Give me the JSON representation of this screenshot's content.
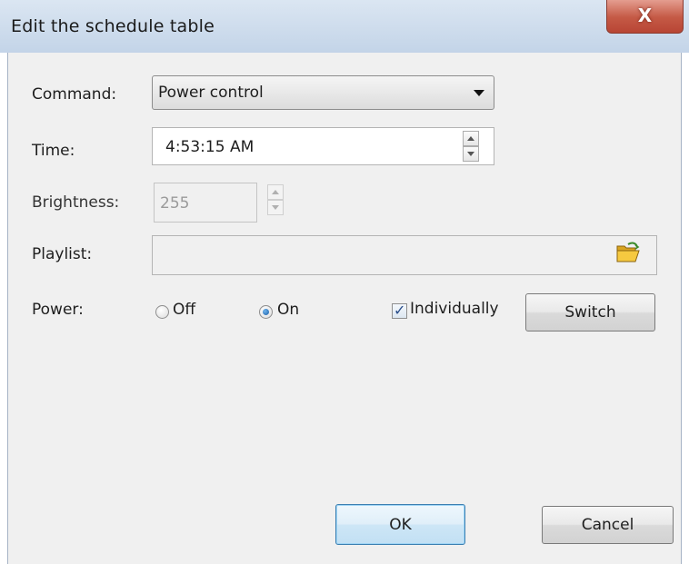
{
  "window": {
    "title": "Edit the schedule table",
    "close_glyph": "X"
  },
  "form": {
    "command_label": "Command:",
    "command_value": "Power control",
    "time_label": "Time:",
    "time_value": "4:53:15 AM",
    "brightness_label": "Brightness:",
    "brightness_value": "255",
    "playlist_label": "Playlist:",
    "playlist_value": "",
    "power_label": "Power:",
    "power_off_label": "Off",
    "power_on_label": "On",
    "power_selected": "On",
    "individually_label": "Individually",
    "individually_checked": true,
    "switch_label": "Switch"
  },
  "footer": {
    "ok_label": "OK",
    "cancel_label": "Cancel"
  },
  "icons": {
    "close": "close-icon",
    "dropdown": "chevron-down-icon",
    "spin_up": "spin-up-icon",
    "spin_down": "spin-down-icon",
    "browse": "folder-open-icon"
  },
  "colors": {
    "title_bar": "#c3d4e8",
    "close_button": "#c55a46",
    "client_bg": "#f0f0f0",
    "default_button_border": "#3c7fb1"
  }
}
